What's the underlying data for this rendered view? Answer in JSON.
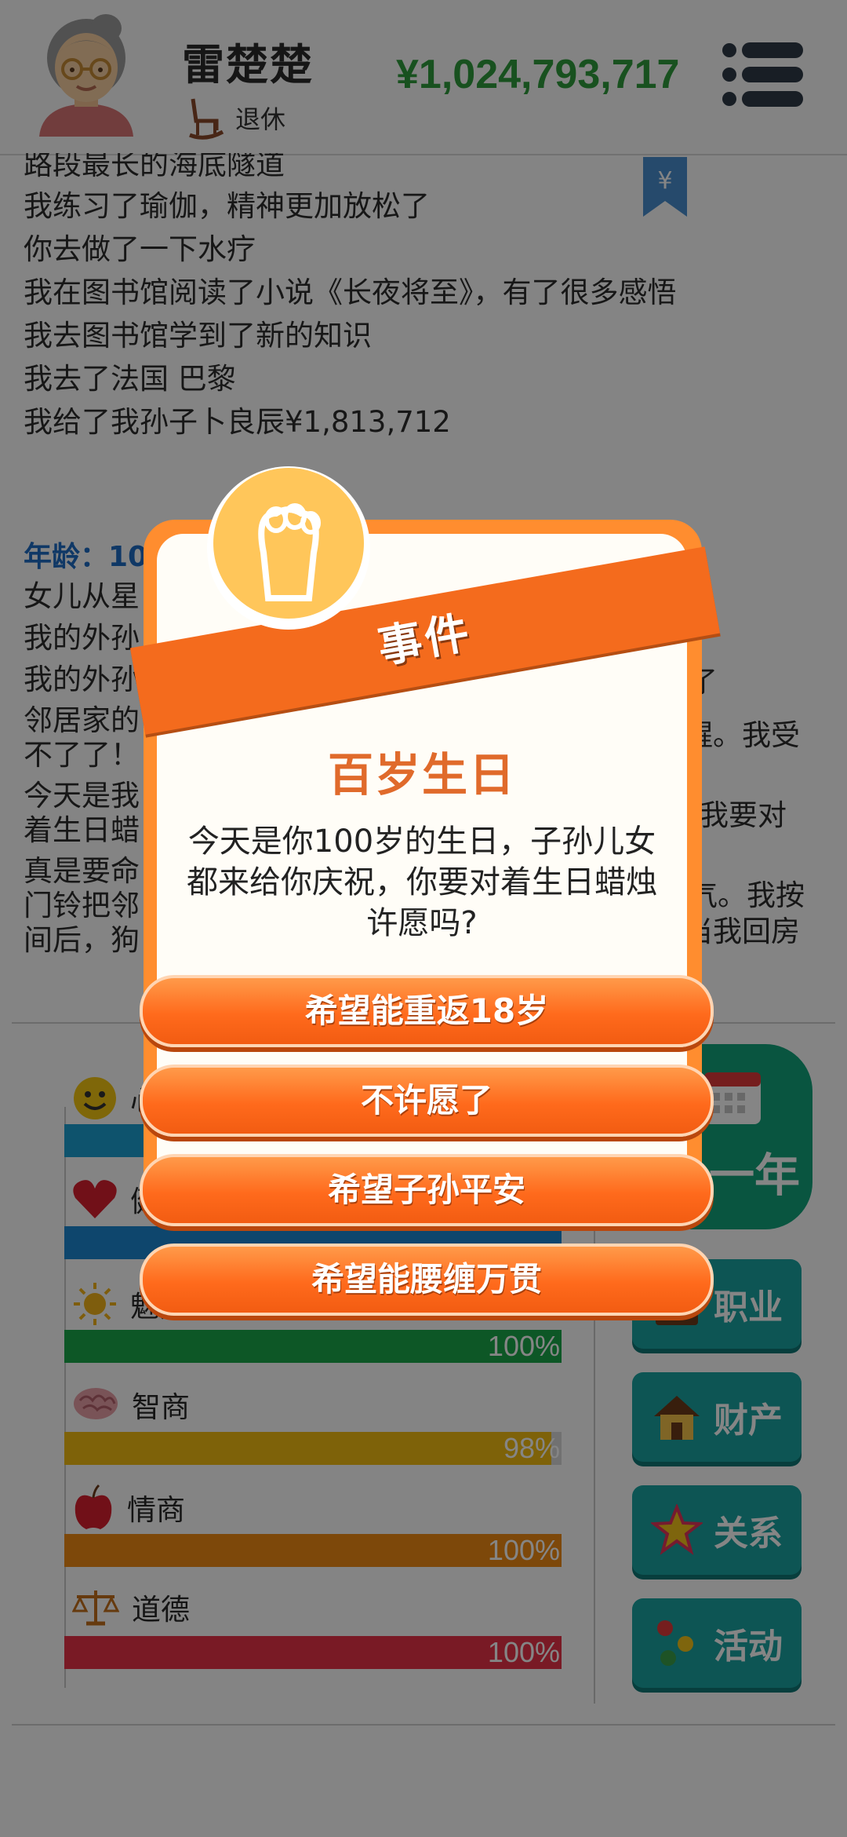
{
  "header": {
    "name": "雷楚楚",
    "status": "退休",
    "money": "¥1,024,793,717"
  },
  "log": {
    "lines_top": [
      "路段最长的海底隧道",
      "我练习了瑜伽，精神更加放松了",
      "你去做了一下水疗",
      "我在图书馆阅读了小说《长夜将至》，有了很多感悟",
      "我去图书馆学到了新的知识",
      "我去了法国 巴黎",
      "我给了我孙子卜良辰¥1,813,712"
    ],
    "age_label": "年龄：10",
    "lines_bottom": [
      "女儿从星",
      "我的外孙",
      "我的外孙",
      "邻居家的",
      "不了了！",
      "今天是我",
      "着生日蜡",
      "真是要命",
      "门铃把邻",
      "间后，狗"
    ],
    "lines_bottom_right": [
      "",
      "",
      "了",
      "醒。我受",
      "",
      "我要对",
      "",
      "气。我按",
      "当我回房",
      ""
    ]
  },
  "stats": [
    {
      "label": "心",
      "pct_text": "",
      "value": 1.0,
      "color": "#1b9fd1"
    },
    {
      "label": "健",
      "pct_text": "",
      "value": 1.0,
      "color": "#1b86d1"
    },
    {
      "label": "魅力",
      "pct_text": "100%",
      "value": 1.0,
      "color": "#1aa84a"
    },
    {
      "label": "智商",
      "pct_text": "98%",
      "value": 0.98,
      "color": "#f1bd12"
    },
    {
      "label": "情商",
      "pct_text": "100%",
      "value": 1.0,
      "color": "#f08a14"
    },
    {
      "label": "道德",
      "pct_text": "100%",
      "value": 1.0,
      "color": "#e83347"
    }
  ],
  "side_buttons": {
    "next_year": "一年",
    "career": "职业",
    "property": "财产",
    "relations": "关系",
    "activities": "活动"
  },
  "dialog": {
    "ribbon": "事件",
    "title": "百岁生日",
    "body": "今天是你100岁的生日，子孙儿女都来给你庆祝，你要对着生日蜡烛许愿吗?",
    "choices": [
      "希望能重返18岁",
      "不许愿了",
      "希望子孙平安",
      "希望能腰缠万贯"
    ]
  }
}
